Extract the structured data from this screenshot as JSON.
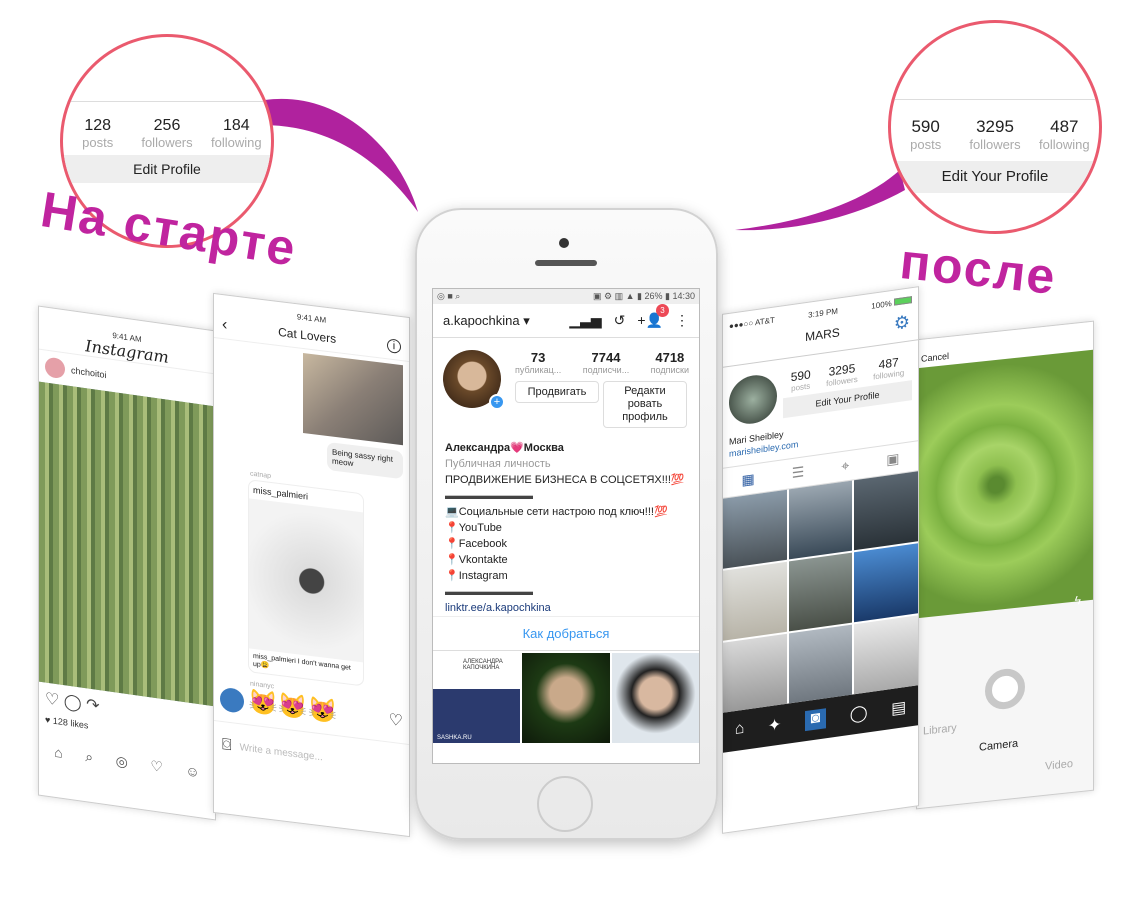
{
  "callouts": {
    "before": {
      "stats": [
        {
          "value": "128",
          "label": "posts"
        },
        {
          "value": "256",
          "label": "followers"
        },
        {
          "value": "184",
          "label": "following"
        }
      ],
      "button": "Edit Profile",
      "caption": "На старте"
    },
    "after": {
      "stats": [
        {
          "value": "590",
          "label": "posts"
        },
        {
          "value": "3295",
          "label": "followers"
        },
        {
          "value": "487",
          "label": "following"
        }
      ],
      "button": "Edit Your Profile",
      "caption": "после"
    }
  },
  "colors": {
    "accent": "#c0249f",
    "ring": "#ea5a6e",
    "ig_blue": "#3897f0",
    "badge": "#ed4956"
  },
  "feed_screen": {
    "time": "9:41 AM",
    "logo": "Instagram",
    "user": "chchoitoi",
    "likes": "128 likes"
  },
  "chat_screen": {
    "time": "9:41 AM",
    "title": "Cat Lovers",
    "message": "Being sassy right meow",
    "sender1": "catnap",
    "shared_user": "miss_palmieri",
    "caption": "miss_palmieri I don't wanna get up😩",
    "sender2": "ninanyc",
    "emojis": "😻😻😻",
    "input_placeholder": "Write a message..."
  },
  "center_phone": {
    "status": {
      "battery": "26%",
      "time": "14:30"
    },
    "username": "a.kapochkina",
    "notification_count": "3",
    "stats": [
      {
        "value": "73",
        "label": "публикац..."
      },
      {
        "value": "7744",
        "label": "подписчи..."
      },
      {
        "value": "4718",
        "label": "подписки"
      }
    ],
    "promote_button": "Продвигать",
    "edit_button": "Редакти ровать профиль",
    "bio": {
      "name": "Александра💗Москва",
      "category": "Публичная личность",
      "lines": [
        "ПРОДВИЖЕНИЕ БИЗНЕСА В СОЦСЕТЯХ!!!💯",
        "▬▬▬▬▬▬▬▬",
        "💻Социальные сети настрою под ключ!!!💯",
        "📍YouTube",
        "📍Facebook",
        "📍Vkontakte",
        "📍Instagram",
        "▬▬▬▬▬▬▬▬"
      ],
      "link": "linktr.ee/a.kapochkina"
    },
    "directions": "Как добраться",
    "thumb_text": "АЛЕКСАНДРА КАПОЧКИНА",
    "thumb_footer": "SASHKA.RU"
  },
  "mars_screen": {
    "carrier": "AT&T",
    "time": "3:19 PM",
    "battery": "100%",
    "title": "MARS",
    "stats": [
      {
        "value": "590",
        "label": "posts"
      },
      {
        "value": "3295",
        "label": "followers"
      },
      {
        "value": "487",
        "label": "following"
      }
    ],
    "button": "Edit Your Profile",
    "name": "Mari Sheibley",
    "link": "marisheibley.com"
  },
  "camera_screen": {
    "cancel": "Cancel",
    "tabs": [
      "Library",
      "Camera",
      "Video"
    ]
  }
}
